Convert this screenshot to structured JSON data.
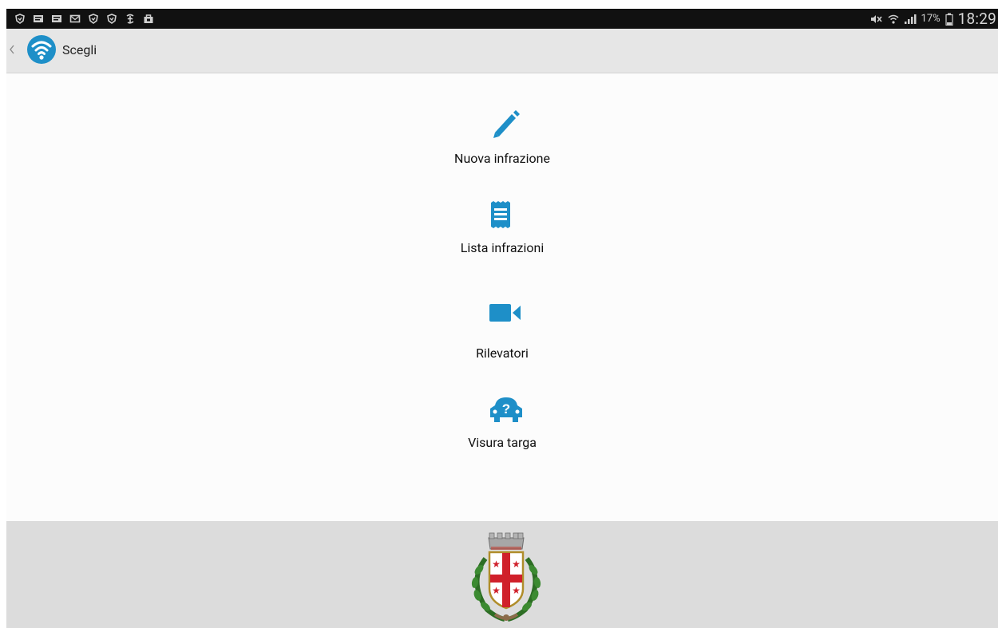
{
  "status_bar": {
    "notification_icons": [
      "antivirus-icon",
      "message-icon",
      "message-icon",
      "email-icon",
      "antivirus-icon",
      "antivirus-icon",
      "nytimes-icon",
      "store-icon"
    ],
    "battery_percent": "17%",
    "clock": "18:29"
  },
  "action_bar": {
    "title": "Scegli"
  },
  "menu": {
    "items": [
      {
        "label": "Nuova infrazione",
        "icon": "pencil-icon"
      },
      {
        "label": "Lista infrazioni",
        "icon": "list-document-icon"
      },
      {
        "label": "Rilevatori",
        "icon": "video-camera-icon"
      },
      {
        "label": "Visura targa",
        "icon": "car-question-icon"
      }
    ]
  },
  "footer": {
    "emblem": "municipal-coat-of-arms"
  },
  "colors": {
    "accent": "#1e8fc8",
    "status_bar": "#111111",
    "action_bar": "#e6e6e6",
    "footer": "#dcdcdc",
    "emblem_red": "#d0202a"
  }
}
